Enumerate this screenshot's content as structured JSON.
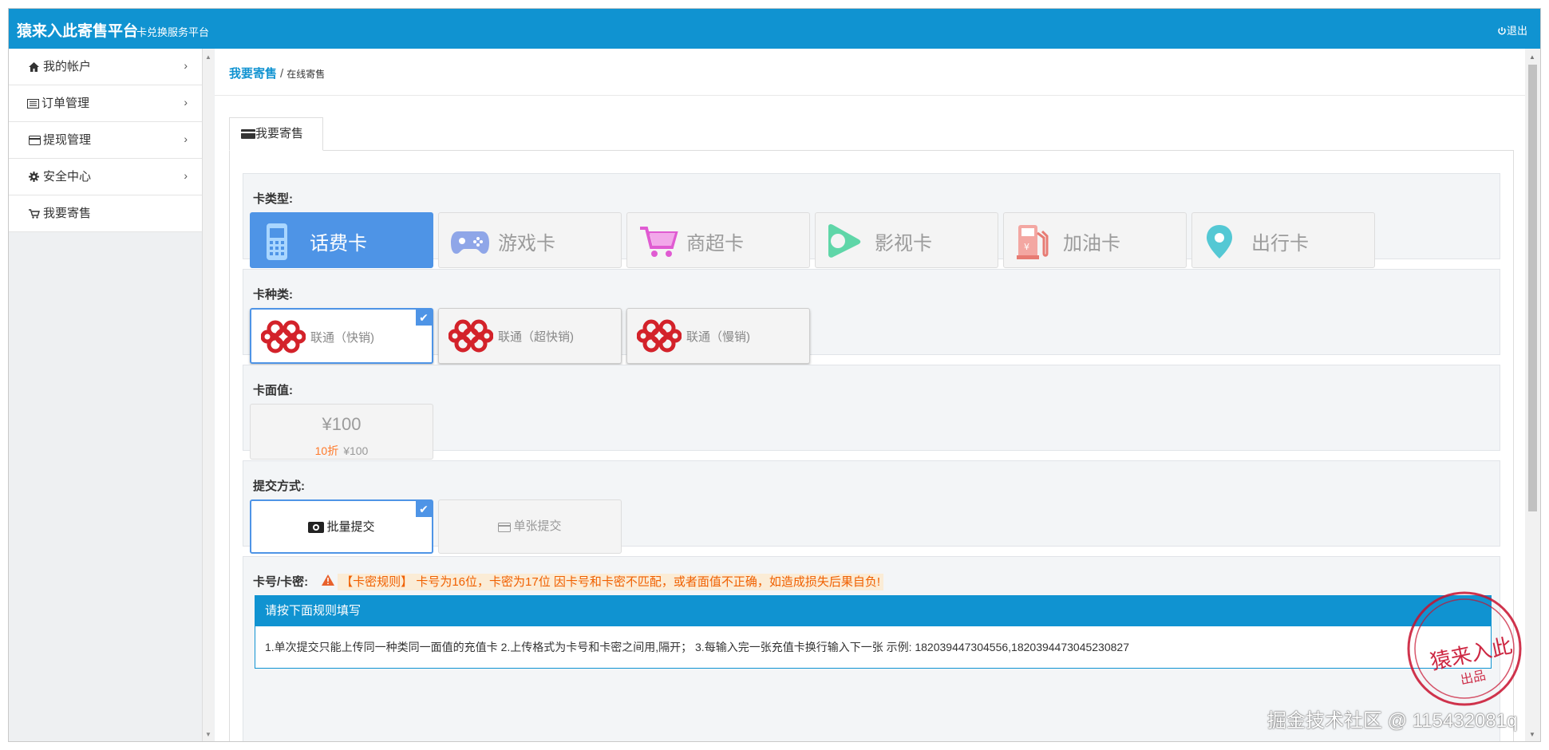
{
  "header": {
    "title": "猿来入此寄售平台",
    "subtitle": "卡兑换服务平台",
    "logout": "退出",
    "color": "#1093d1"
  },
  "sidebar": {
    "items": [
      {
        "label": "我的帐户",
        "icon": "home-icon"
      },
      {
        "label": "订单管理",
        "icon": "list-icon"
      },
      {
        "label": "提现管理",
        "icon": "card-icon"
      },
      {
        "label": "安全中心",
        "icon": "gear-icon"
      },
      {
        "label": "我要寄售",
        "icon": "cart-icon"
      }
    ]
  },
  "breadcrumb": {
    "active": "我要寄售",
    "separator": "/",
    "current": "在线寄售"
  },
  "tab": {
    "label": "我要寄售"
  },
  "card_type": {
    "label": "卡类型:",
    "options": [
      {
        "label": "话费卡",
        "icon": "phone-icon",
        "selected": true
      },
      {
        "label": "游戏卡",
        "icon": "gamepad-icon",
        "selected": false
      },
      {
        "label": "商超卡",
        "icon": "shopping-cart-icon",
        "selected": false
      },
      {
        "label": "影视卡",
        "icon": "play-icon",
        "selected": false
      },
      {
        "label": "加油卡",
        "icon": "fuel-icon",
        "selected": false
      },
      {
        "label": "出行卡",
        "icon": "location-pin-icon",
        "selected": false
      }
    ]
  },
  "card_kind": {
    "label": "卡种类:",
    "options": [
      {
        "label": "联通（快销)",
        "selected": true
      },
      {
        "label": "联通（超快销)",
        "selected": false
      },
      {
        "label": "联通（慢销)",
        "selected": false
      }
    ]
  },
  "card_value": {
    "label": "卡面值:",
    "value": "¥100",
    "discount": "10折",
    "sub_value": "¥100"
  },
  "submit_mode": {
    "label": "提交方式:",
    "options": [
      {
        "label": "批量提交",
        "selected": true
      },
      {
        "label": "单张提交",
        "selected": false
      }
    ]
  },
  "card_secret": {
    "label": "卡号/卡密:",
    "rule": "【卡密规则】 卡号为16位，卡密为17位 因卡号和卡密不匹配，或者面值不正确，如造成损失后果自负!",
    "info_title": "请按下面规则填写",
    "info_body": "1.单次提交只能上传同一种类同一面值的充值卡 2.上传格式为卡号和卡密之间用,隔开；  3.每输入完一张充值卡换行输入下一张 示例: 182039447304556,18203944730452308​27"
  },
  "seal": {
    "text": "猿来入此",
    "sub": "出品"
  },
  "watermark": "掘金技术社区 @ 1154320​81q"
}
